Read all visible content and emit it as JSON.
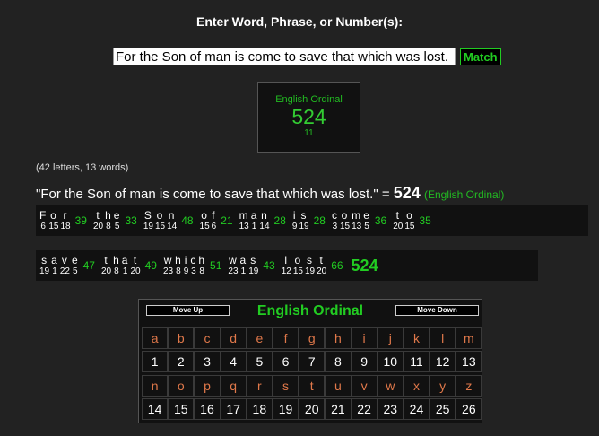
{
  "prompt": "Enter Word, Phrase, or Number(s):",
  "input": {
    "value": "For the Son of man is come to save that which was lost."
  },
  "match_label": "Match",
  "cipher_box": {
    "name": "English Ordinal",
    "value": "524",
    "sub": "11"
  },
  "counts": "(42 letters, 13 words)",
  "result": {
    "phrase": "\"For the Son of man is come to save that which was lost.\" =",
    "value": "524",
    "cipher": "(English Ordinal)"
  },
  "rows": [
    {
      "words": [
        {
          "letters": [
            [
              "F",
              "6"
            ],
            [
              "o",
              "15"
            ],
            [
              "r",
              "18"
            ]
          ],
          "sum": "39"
        },
        {
          "letters": [
            [
              "t",
              "20"
            ],
            [
              "h",
              "8"
            ],
            [
              "e",
              "5"
            ]
          ],
          "sum": "33"
        },
        {
          "letters": [
            [
              "S",
              "19"
            ],
            [
              "o",
              "15"
            ],
            [
              "n",
              "14"
            ]
          ],
          "sum": "48"
        },
        {
          "letters": [
            [
              "o",
              "15"
            ],
            [
              "f",
              "6"
            ]
          ],
          "sum": "21"
        },
        {
          "letters": [
            [
              "m",
              "13"
            ],
            [
              "a",
              "1"
            ],
            [
              "n",
              "14"
            ]
          ],
          "sum": "28"
        },
        {
          "letters": [
            [
              "i",
              "9"
            ],
            [
              "s",
              "19"
            ]
          ],
          "sum": "28"
        },
        {
          "letters": [
            [
              "c",
              "3"
            ],
            [
              "o",
              "15"
            ],
            [
              "m",
              "13"
            ],
            [
              "e",
              "5"
            ]
          ],
          "sum": "36"
        },
        {
          "letters": [
            [
              "t",
              "20"
            ],
            [
              "o",
              "15"
            ]
          ],
          "sum": "35"
        }
      ],
      "total": ""
    },
    {
      "words": [
        {
          "letters": [
            [
              "s",
              "19"
            ],
            [
              "a",
              "1"
            ],
            [
              "v",
              "22"
            ],
            [
              "e",
              "5"
            ]
          ],
          "sum": "47"
        },
        {
          "letters": [
            [
              "t",
              "20"
            ],
            [
              "h",
              "8"
            ],
            [
              "a",
              "1"
            ],
            [
              "t",
              "20"
            ]
          ],
          "sum": "49"
        },
        {
          "letters": [
            [
              "w",
              "23"
            ],
            [
              "h",
              "8"
            ],
            [
              "i",
              "9"
            ],
            [
              "c",
              "3"
            ],
            [
              "h",
              "8"
            ]
          ],
          "sum": "51"
        },
        {
          "letters": [
            [
              "w",
              "23"
            ],
            [
              "a",
              "1"
            ],
            [
              "s",
              "19"
            ]
          ],
          "sum": "43"
        },
        {
          "letters": [
            [
              "l",
              "12"
            ],
            [
              "o",
              "15"
            ],
            [
              "s",
              "19"
            ],
            [
              "t",
              "20"
            ]
          ],
          "sum": "66"
        }
      ],
      "total": "524"
    }
  ],
  "table": {
    "move_up": "Move Up",
    "move_down": "Move Down",
    "title": "English Ordinal",
    "letters1": [
      "a",
      "b",
      "c",
      "d",
      "e",
      "f",
      "g",
      "h",
      "i",
      "j",
      "k",
      "l",
      "m"
    ],
    "nums1": [
      "1",
      "2",
      "3",
      "4",
      "5",
      "6",
      "7",
      "8",
      "9",
      "10",
      "11",
      "12",
      "13"
    ],
    "letters2": [
      "n",
      "o",
      "p",
      "q",
      "r",
      "s",
      "t",
      "u",
      "v",
      "w",
      "x",
      "y",
      "z"
    ],
    "nums2": [
      "14",
      "15",
      "16",
      "17",
      "18",
      "19",
      "20",
      "21",
      "22",
      "23",
      "24",
      "25",
      "26"
    ]
  },
  "colors": {
    "background": "#222222",
    "accent_green": "#22cc22",
    "letter_orange": "#e0784a"
  }
}
